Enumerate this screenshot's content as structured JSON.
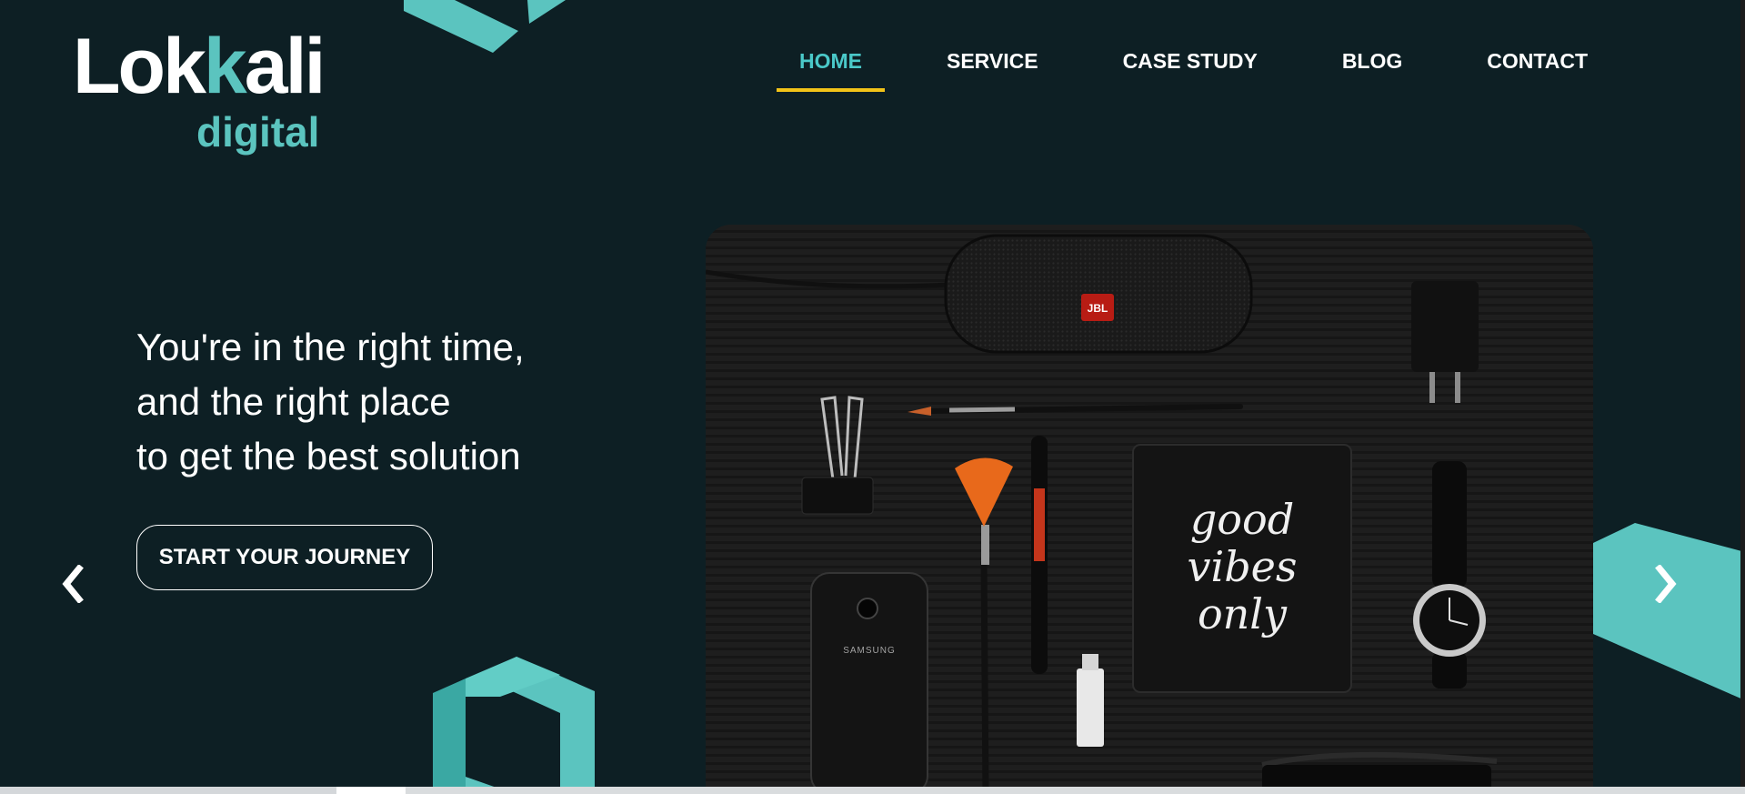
{
  "brand": {
    "logo_main": "Lok",
    "logo_k": "k",
    "logo_rest": "ali",
    "logo_sub": "digital",
    "primary_color": "#5bc4bf",
    "background_color": "#0d1f24",
    "nav_active_color": "#4ac9c9",
    "nav_underline_color": "#f2c318"
  },
  "nav": {
    "items": [
      {
        "label": "HOME",
        "active": true
      },
      {
        "label": "SERVICE",
        "active": false
      },
      {
        "label": "CASE STUDY",
        "active": false
      },
      {
        "label": "BLOG",
        "active": false
      },
      {
        "label": "CONTACT",
        "active": false
      }
    ]
  },
  "hero": {
    "lines": [
      "You're in the right time,",
      "and the right place",
      "to get the best solution"
    ],
    "cta_label": "START YOUR JOURNEY"
  },
  "carousel": {
    "prev_icon": "chevron-left-icon",
    "next_icon": "chevron-right-icon"
  },
  "photo": {
    "speaker_brand": "JBL",
    "notebook_lines": [
      "good",
      "vibes",
      "only"
    ],
    "phone_brand": "SAMSUNG"
  }
}
